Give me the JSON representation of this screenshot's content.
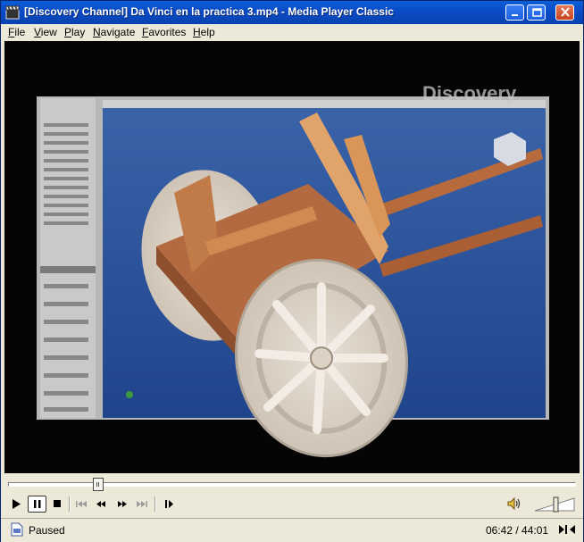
{
  "window": {
    "title": "[Discovery Channel] Da Vinci en la practica 3.mp4 - Media Player Classic",
    "app_icon": "film-clapper-icon",
    "buttons": [
      "minimize-icon",
      "maximize-icon",
      "close-icon"
    ]
  },
  "menu": [
    {
      "label": "File"
    },
    {
      "label": "View"
    },
    {
      "label": "Play"
    },
    {
      "label": "Navigate"
    },
    {
      "label": "Favorites"
    },
    {
      "label": "Help"
    }
  ],
  "video": {
    "watermark": "Discovery",
    "scene": "screen-capture of 3D CAD software showing a wooden wheeled cart model"
  },
  "playback": {
    "position_fraction": 0.153,
    "volume_fraction": 0.55,
    "state_icon": "pause"
  },
  "controls": [
    "play-icon",
    "pause-icon",
    "stop-icon",
    "prev-icon",
    "rewind-icon",
    "fast-forward-icon",
    "next-icon",
    "frame-step-icon",
    "speaker-icon"
  ],
  "status": {
    "state": "Paused",
    "time": "06:42 / 44:01"
  }
}
